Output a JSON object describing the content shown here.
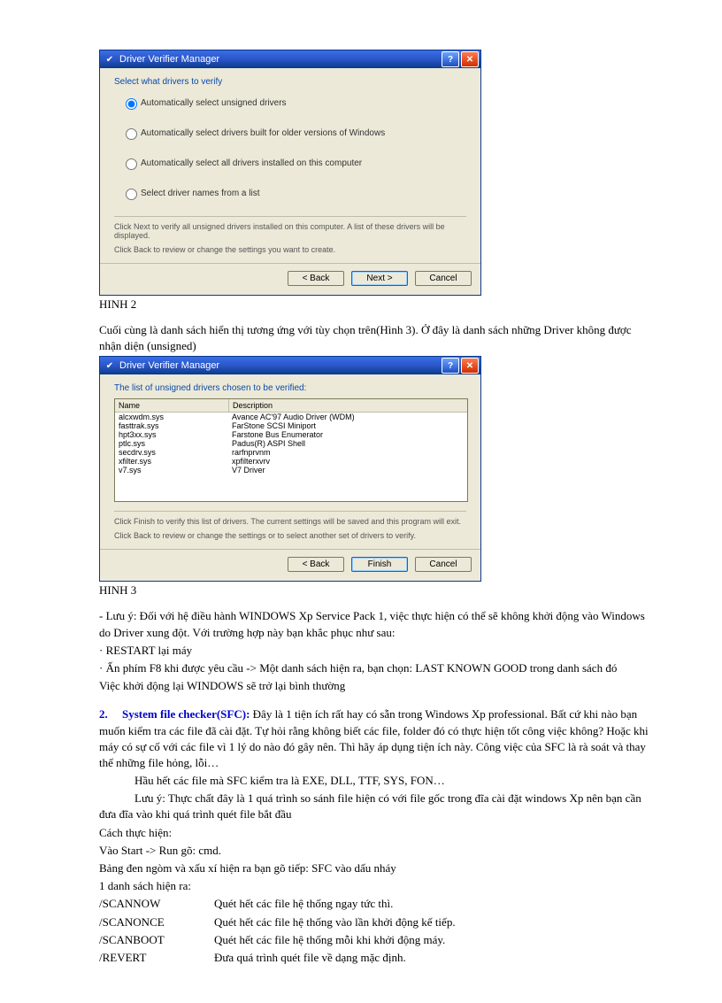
{
  "dialog1": {
    "title": "Driver Verifier Manager",
    "section_label": "Select what drivers to verify",
    "options": [
      "Automatically select unsigned drivers",
      "Automatically select drivers built for older versions of Windows",
      "Automatically select all drivers installed on this computer",
      "Select driver names from a list"
    ],
    "hint1": "Click Next to verify all unsigned drivers installed on this computer. A list of these drivers will be displayed.",
    "hint2": "Click Back to review or change the settings you want to create.",
    "buttons": {
      "back": "< Back",
      "next": "Next >",
      "cancel": "Cancel"
    }
  },
  "caption1": "HINH 2",
  "para1": "Cuối cùng là danh sách hiển thị tương ứng với tùy chọn trên(Hình  3). Ở đây là danh sách những Driver  không được nhận diện (unsigned)",
  "dialog2": {
    "title": "Driver Verifier Manager",
    "section_label": "The list of unsigned drivers chosen to be verified:",
    "headers": {
      "name": "Name",
      "desc": "Description"
    },
    "rows": [
      {
        "name": "alcxwdm.sys",
        "desc": "Avance AC'97 Audio Driver (WDM)"
      },
      {
        "name": "fasttrak.sys",
        "desc": "FarStone SCSI Miniport"
      },
      {
        "name": "hpt3xx.sys",
        "desc": "Farstone Bus Enumerator"
      },
      {
        "name": "ptlc.sys",
        "desc": "Padus(R) ASPI Shell"
      },
      {
        "name": "secdrv.sys",
        "desc": "rarfnprvnm"
      },
      {
        "name": "xfilter.sys",
        "desc": "xpfilterxvrv"
      },
      {
        "name": "v7.sys",
        "desc": "V7 Driver"
      }
    ],
    "hint1": "Click Finish to verify this list of drivers. The current settings will be saved and this program will exit.",
    "hint2": "Click Back to review or change the settings or to select another set of drivers to verify.",
    "buttons": {
      "back": "< Back",
      "finish": "Finish",
      "cancel": "Cancel"
    }
  },
  "caption2": "HINH 3",
  "lines": {
    "l1": "-          Lưu ý: Đối với hệ điều hành WINDOWS Xp Service Pack 1, việc thực hiện có thể sẽ không khởi động vào Windows do Driver xung đột. Với trường hợp này bạn khắc phục như sau:",
    "l2": "·  RESTART lại máy",
    "l3": "·  Ấn phím F8 khi được yêu cầu -> Một danh sách hiện ra, bạn chọn: LAST KNOWN GOOD trong danh sách đó",
    "l4": "Việc khởi động lại WINDOWS sẽ trở lại bình thường",
    "sec_num": "2.",
    "sec_title": "System file checker(SFC):",
    "sec_body": " Đây là 1 tiện ích rất hay có sẵn trong Windows Xp professional. Bất cứ khi nào bạn muốn kiểm tra các file đã cài đặt. Tự hỏi rằng không biết các file, folder đó có thực hiện tốt công việc không? Hoặc khi máy có sự cố với các file vì 1 lý do nào đó gây nên. Thì hãy áp dụng tiện ích này. Công việc của SFC là rà soát và thay thế những file hỏng, lỗi…",
    "l5": "Hầu hết các file mà SFC kiểm tra là EXE, DLL, TTF, SYS, FON…",
    "l6": "Lưu ý: Thực chất đây là 1 quá trình so sánh file hiện có với file gốc trong đĩa cài đặt windows Xp nên bạn cần đưa đĩa vào khi quá trình quét file bắt đầu",
    "l7": "Cách thực hiện:",
    "l8": "Vào Start -> Run gõ: cmd.",
    "l9": "Bảng đen ngòm và xấu xí hiện ra bạn gõ tiếp: SFC vào dấu nháy",
    "l10": "1 danh sách hiện ra:",
    "cmds": [
      {
        "c": "/SCANNOW",
        "d": "Quét hết các file hệ thống ngay tức thì."
      },
      {
        "c": "/SCANONCE",
        "d": "Quét hết các file hệ thống vào lần khởi động kế tiếp."
      },
      {
        "c": "/SCANBOOT",
        "d": "Quét hết các file hệ thống mỗi khi khởi động máy."
      },
      {
        "c": "/REVERT",
        "d": "Đưa quá trình quét file về dạng mặc định."
      }
    ]
  }
}
